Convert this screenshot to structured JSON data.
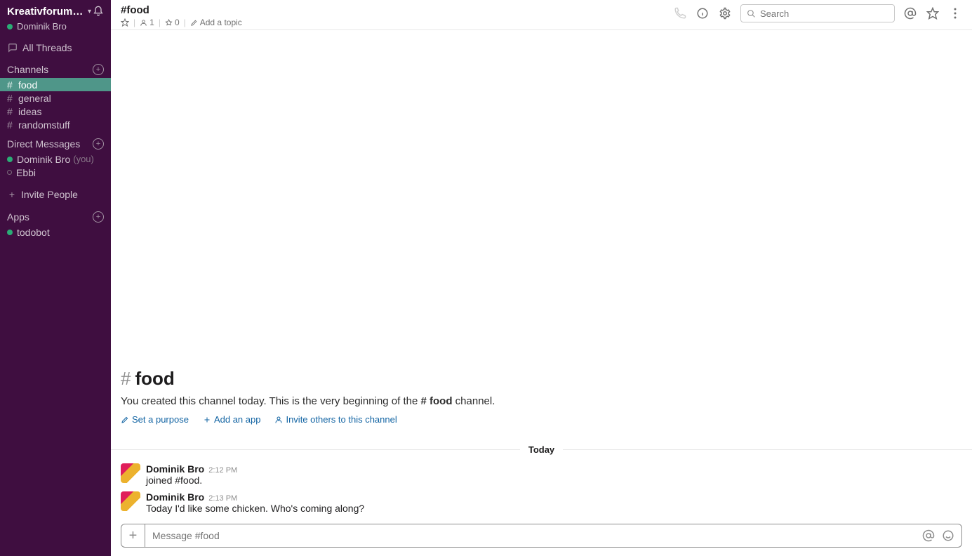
{
  "workspace": {
    "name": "Kreativforum Fr…",
    "user": "Dominik Bro"
  },
  "sidebar": {
    "all_threads": "All Threads",
    "channels_label": "Channels",
    "channels": [
      {
        "name": "food",
        "active": true
      },
      {
        "name": "general",
        "active": false
      },
      {
        "name": "ideas",
        "active": false
      },
      {
        "name": "randomstuff",
        "active": false
      }
    ],
    "dm_label": "Direct Messages",
    "dms": [
      {
        "name": "Dominik Bro",
        "you": "(you)",
        "online": true
      },
      {
        "name": "Ebbi",
        "you": "",
        "online": false
      }
    ],
    "invite": "Invite People",
    "apps_label": "Apps",
    "apps": [
      {
        "name": "todobot"
      }
    ]
  },
  "header": {
    "channel_title": "#food",
    "members": "1",
    "pins": "0",
    "add_topic": "Add a topic",
    "search_placeholder": "Search"
  },
  "intro": {
    "hash": "#",
    "name": "food",
    "text_before": "You created this channel today. This is the very beginning of the ",
    "text_channel": "# food",
    "text_after": " channel.",
    "links": {
      "purpose": "Set a purpose",
      "add_app": "Add an app",
      "invite": "Invite others to this channel"
    }
  },
  "divider": "Today",
  "messages": [
    {
      "author": "Dominik Bro",
      "time": "2:12 PM",
      "text": "joined #food."
    },
    {
      "author": "Dominik Bro",
      "time": "2:13 PM",
      "text": "Today I'd like some chicken. Who's coming along?"
    }
  ],
  "composer": {
    "placeholder": "Message #food"
  }
}
